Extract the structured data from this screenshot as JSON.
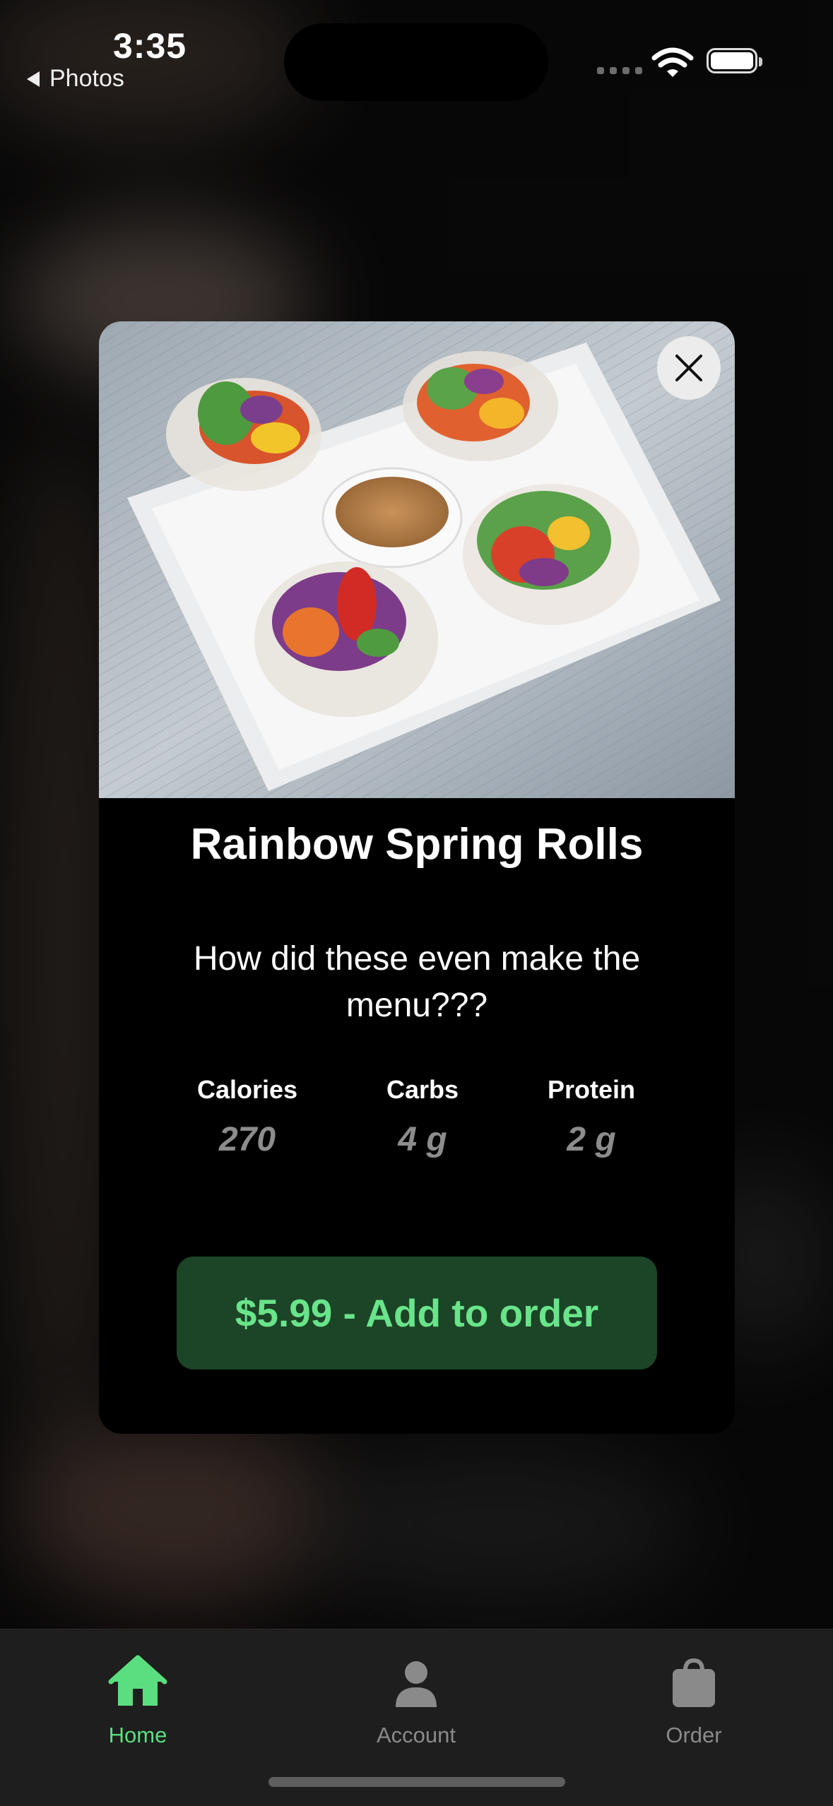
{
  "status_bar": {
    "time": "3:35",
    "back_app": "Photos"
  },
  "item": {
    "name": "Rainbow Spring Rolls",
    "description": "How did these even make the menu???",
    "image_alt": "Rainbow spring rolls on a white square plate with dipping sauce"
  },
  "nutrition": [
    {
      "label": "Calories",
      "value": "270"
    },
    {
      "label": "Carbs",
      "value": "4 g"
    },
    {
      "label": "Protein",
      "value": "2 g"
    }
  ],
  "cta": {
    "label": "$5.99 - Add to order"
  },
  "tabs": [
    {
      "label": "Home",
      "icon": "home-icon",
      "active": true
    },
    {
      "label": "Account",
      "icon": "person-icon",
      "active": false
    },
    {
      "label": "Order",
      "icon": "bag-icon",
      "active": false
    }
  ],
  "colors": {
    "accent": "#5bde7f",
    "cta_bg": "#1c4427",
    "cta_text": "#69e48a",
    "muted": "#8c8c8c"
  }
}
